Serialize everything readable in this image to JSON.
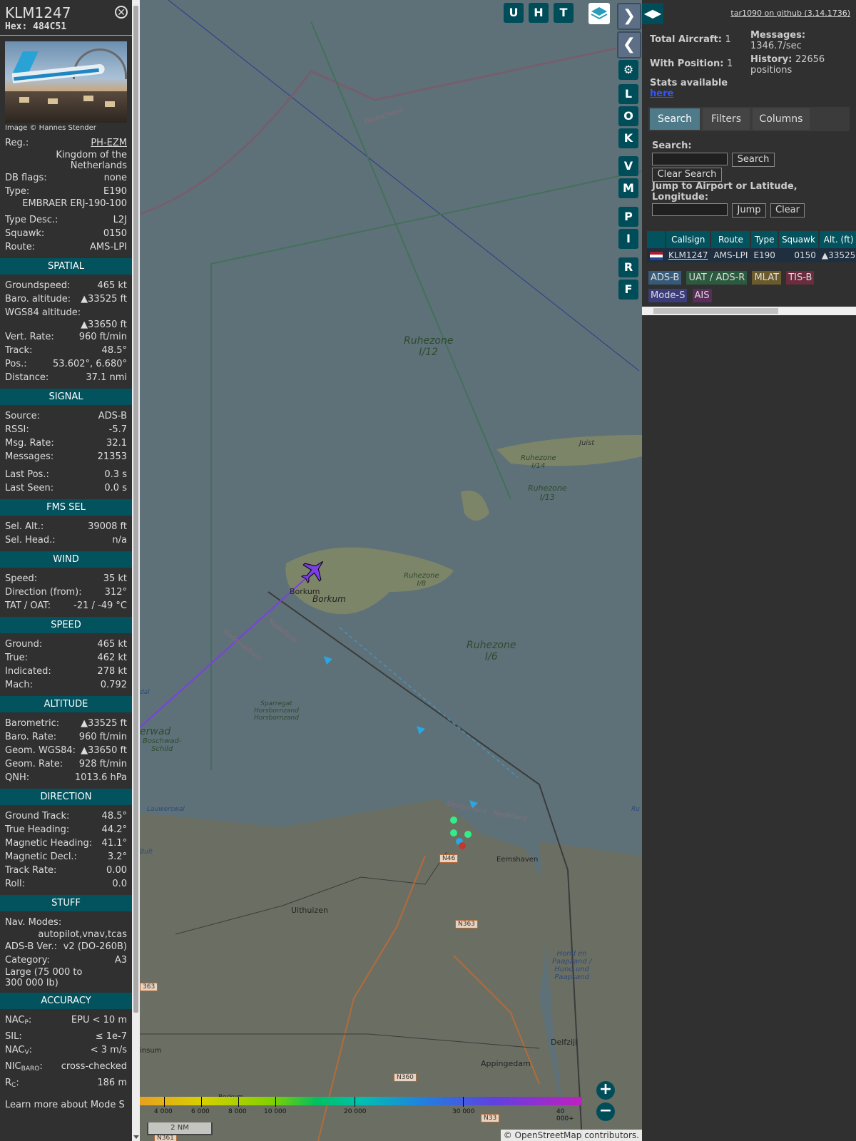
{
  "aircraft": {
    "callsign": "KLM1247",
    "hex": "Hex: 484C51",
    "image_credit": "Image © Hannes Stender",
    "reg_label": "Reg.:",
    "reg": "PH-EZM",
    "country": "Kingdom of the Netherlands",
    "dbflags_label": "DB flags:",
    "dbflags": "none",
    "type_label": "Type:",
    "type": "E190",
    "type_full": "EMBRAER ERJ-190-100",
    "typedesc_label": "Type Desc.:",
    "typedesc": "L2J",
    "squawk_label": "Squawk:",
    "squawk": "0150",
    "route_label": "Route:",
    "route": "AMS-LPI"
  },
  "spatial": {
    "title": "SPATIAL",
    "groundspeed_label": "Groundspeed:",
    "groundspeed": "465 kt",
    "baro_label": "Baro. altitude:",
    "baro": "▲33525 ft",
    "wgs_label": "WGS84 altitude:",
    "wgs": "▲33650 ft",
    "vrate_label": "Vert. Rate:",
    "vrate": "960 ft/min",
    "track_label": "Track:",
    "track": "48.5°",
    "pos_label": "Pos.:",
    "pos": "53.602°, 6.680°",
    "dist_label": "Distance:",
    "dist": "37.1 nmi"
  },
  "signal": {
    "title": "SIGNAL",
    "source_label": "Source:",
    "source": "ADS-B",
    "rssi_label": "RSSI:",
    "rssi": "-5.7",
    "msgrate_label": "Msg. Rate:",
    "msgrate": "32.1",
    "messages_label": "Messages:",
    "messages": "21353",
    "lastpos_label": "Last Pos.:",
    "lastpos": "0.3 s",
    "lastseen_label": "Last Seen:",
    "lastseen": "0.0 s"
  },
  "fms": {
    "title": "FMS SEL",
    "selalt_label": "Sel. Alt.:",
    "selalt": "39008 ft",
    "selhead_label": "Sel. Head.:",
    "selhead": "n/a"
  },
  "wind": {
    "title": "WIND",
    "speed_label": "Speed:",
    "speed": "35 kt",
    "dir_label": "Direction (from):",
    "dir": "312°",
    "tat_label": "TAT / OAT:",
    "tat": "-21 / -49 °C"
  },
  "speed": {
    "title": "SPEED",
    "ground_label": "Ground:",
    "ground": "465 kt",
    "true_label": "True:",
    "true": "462 kt",
    "ind_label": "Indicated:",
    "ind": "278 kt",
    "mach_label": "Mach:",
    "mach": "0.792"
  },
  "altitude": {
    "title": "ALTITUDE",
    "baro_label": "Barometric:",
    "baro": "▲33525 ft",
    "barorate_label": "Baro. Rate:",
    "barorate": "960 ft/min",
    "geom_label": "Geom. WGS84:",
    "geom": "▲33650 ft",
    "geomrate_label": "Geom. Rate:",
    "geomrate": "928 ft/min",
    "qnh_label": "QNH:",
    "qnh": "1013.6 hPa"
  },
  "direction": {
    "title": "DIRECTION",
    "gt_label": "Ground Track:",
    "gt": "48.5°",
    "th_label": "True Heading:",
    "th": "44.2°",
    "mh_label": "Magnetic Heading:",
    "mh": "41.1°",
    "md_label": "Magnetic Decl.:",
    "md": "3.2°",
    "tr_label": "Track Rate:",
    "tr": "0.00",
    "roll_label": "Roll:",
    "roll": "0.0"
  },
  "stuff": {
    "title": "STUFF",
    "nav_label": "Nav. Modes:",
    "nav": "autopilot,vnav,tcas",
    "adsb_label": "ADS-B Ver.:",
    "adsb": "v2 (DO-260B)",
    "cat_label": "Category:",
    "cat": "A3",
    "cat_desc": "Large (75 000 to 300 000 lb)"
  },
  "accuracy": {
    "title": "ACCURACY",
    "nacp_label": "NAC",
    "nacp_sub": "P",
    "nacp": "EPU < 10 m",
    "sil_label": "SIL:",
    "sil": "≤ 1e-7",
    "nacv_label": "NAC",
    "nacv_sub": "V",
    "nacv": "< 3 m/s",
    "nic_label": "NIC",
    "nic_sub": "BARO",
    "nic": "cross-checked",
    "rc_label": "R",
    "rc_sub": "C",
    "rc": "186 m",
    "learn": "Learn more about Mode S"
  },
  "map": {
    "buttons": [
      "U",
      "H",
      "T"
    ],
    "side_buttons": [
      "L",
      "O",
      "K",
      "V",
      "M",
      "P",
      "I",
      "R",
      "F"
    ],
    "labels": {
      "ruhezone12": "Ruhezone",
      "ruhezone12b": "I/12",
      "ruhezone6": "Ruhezone",
      "ruhezone6b": "I/6",
      "borkum1": "Borkum",
      "borkum2": "Borkum",
      "juist": "Juist",
      "uithuizen": "Uithuizen",
      "eemshaven": "Eemshaven",
      "delfzijl": "Delfzijl",
      "appingedam": "Appingedam",
      "n46": "N46",
      "n363": "N363",
      "n360": "N360",
      "n33": "N33",
      "n361": "N361",
      "n363b": "363",
      "deutschland1": "Deutschland",
      "deutschland2": "Deutschland",
      "nederland1": "Nederland",
      "nederland2": "Nederland",
      "niedersachsen": "Niedersachsen",
      "boschwad": "Boschwad-",
      "schild": "Schild",
      "erwad": "erwad",
      "sparregat": "Sparregat",
      "horsborn1": "Horsbornzand",
      "horsborn2": "Horsbornzand",
      "hond1": "Hond en",
      "hond2": "Paapzand /",
      "hond3": "Hund und",
      "hond4": "Paapsand",
      "lauwerswal": "Lauwerswal",
      "rz14": "Ruhezone",
      "rz14b": "I/14",
      "rz13": "Ruhezone",
      "rz13b": "I/13",
      "rz8": "Ruhezone",
      "rz8b": "I/8",
      "insum": "insum",
      "bult": "Bult",
      "dal": "dal",
      "ru": "Ru",
      "borkum_s": "Borkum"
    },
    "legend_ticks": [
      "4 000",
      "6 000",
      "8 000",
      "10 000",
      "20 000",
      "30 000",
      "40 000+"
    ],
    "scale": "2 NM",
    "attribution_prefix": "© ",
    "attribution_link": "OpenStreetMap",
    "attribution_suffix": " contributors."
  },
  "right": {
    "github": "tar1090 on github (3.14.1736)",
    "total_label": "Total Aircraft:",
    "total": "1",
    "withpos_label": "With Position:",
    "withpos": "1",
    "stats_label": "Stats available",
    "stats_link": "here",
    "messages_label": "Messages:",
    "messages": "1346.7/sec",
    "history_label": "History:",
    "history": "22656 positions",
    "tabs": [
      "Search",
      "Filters",
      "Columns"
    ],
    "search_label": "Search:",
    "search_btn": "Search",
    "clear_search_btn": "Clear Search",
    "jump_label": "Jump to Airport or Latitude, Longitude:",
    "jump_btn": "Jump",
    "clear_btn": "Clear",
    "columns": [
      "Callsign",
      "Route",
      "Type",
      "Squawk",
      "Alt. (ft)"
    ],
    "row": {
      "callsign": "KLM1247",
      "route": "AMS-LPI",
      "type": "E190",
      "squawk": "0150",
      "alt": "▲33525"
    },
    "badges": [
      "ADS-B",
      "UAT / ADS-R",
      "MLAT",
      "TIS-B",
      "Mode-S",
      "AIS"
    ]
  }
}
